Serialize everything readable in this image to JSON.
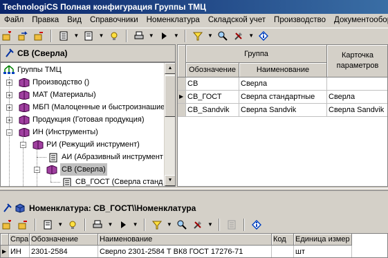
{
  "window": {
    "title": "TechnologiCS Полная конфигурация Группы ТМЦ"
  },
  "menu": [
    "Файл",
    "Правка",
    "Вид",
    "Справочники",
    "Номенклатура",
    "Складской учет",
    "Производство",
    "Документооборот"
  ],
  "top_panel": {
    "title": "СВ (Сверла)"
  },
  "tree": {
    "root": "Группы ТМЦ",
    "items": [
      {
        "label": "Производство ()"
      },
      {
        "label": "МАТ (Материалы)"
      },
      {
        "label": "МБП (Малоценные и быстроизнашие"
      },
      {
        "label": "Продукция (Готовая продукция)"
      },
      {
        "label": "ИН (Инструменты)"
      },
      {
        "label": "РИ (Режущий инструмент)"
      },
      {
        "label": "АИ (Абразивный инструмент"
      },
      {
        "label": "СВ (Сверла)"
      },
      {
        "label": "СВ_ГОСТ (Сверла станд"
      }
    ]
  },
  "group_grid": {
    "header_group": "Группа",
    "header_card": "Карточка параметров",
    "col_designation": "Обозначение",
    "col_name": "Наименование",
    "rows": [
      {
        "designation": "СВ",
        "name": "Сверла",
        "card": ""
      },
      {
        "designation": "СВ_ГОСТ",
        "name": "Сверла стандартные",
        "card": "Сверла"
      },
      {
        "designation": "СВ_Sandvik",
        "name": "Сверла Sandvik",
        "card": "Сверла Sandvik"
      }
    ]
  },
  "bottom_panel": {
    "title": "Номенклатура: СВ_ГОСТ\\\\Номенклатура"
  },
  "nomen_grid": {
    "headers": [
      "Спра",
      "Обозначение",
      "Наименование",
      "Код",
      "Единица измер"
    ],
    "rows": [
      {
        "ref": "ИН",
        "designation": "2301-2584",
        "name": "Сверло 2301-2584 Т ВК8 ГОСТ 17276-71",
        "code": "",
        "unit": "шт"
      }
    ]
  },
  "icons": [
    "new-icon",
    "delete-icon",
    "properties-icon",
    "print-icon",
    "run-icon",
    "filter-icon",
    "search-icon",
    "tools-icon",
    "info-icon",
    "cube-icon",
    "book-icon",
    "tree-root-icon",
    "document-icon"
  ]
}
